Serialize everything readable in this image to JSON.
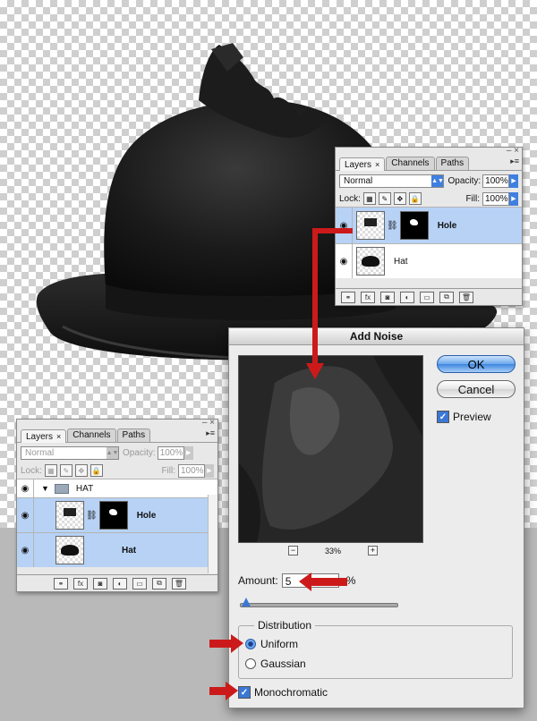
{
  "colors": {
    "selection": "#b7d2f5",
    "accent_blue": "#3f7fe0",
    "annotation_red": "#cc1a1a"
  },
  "layers_top": {
    "tabs": [
      {
        "label": "Layers",
        "close": "×"
      },
      {
        "label": "Channels"
      },
      {
        "label": "Paths"
      }
    ],
    "menu_icon": "▸≡",
    "blend_mode": "Normal",
    "opacity_label": "Opacity:",
    "opacity_value": "100%",
    "lock_label": "Lock:",
    "fill_label": "Fill:",
    "fill_value": "100%",
    "layers": [
      {
        "name": "Hole",
        "selected": true
      },
      {
        "name": "Hat",
        "selected": false
      }
    ],
    "eye_icon": "eye-icon"
  },
  "layers_bottom": {
    "tabs": [
      {
        "label": "Layers",
        "close": "×"
      },
      {
        "label": "Channels"
      },
      {
        "label": "Paths"
      }
    ],
    "blend_mode": "Normal",
    "opacity_label": "Opacity:",
    "opacity_value": "100%",
    "lock_label": "Lock:",
    "fill_label": "Fill:",
    "fill_value": "100%",
    "group": {
      "name": "HAT"
    },
    "layers": [
      {
        "name": "Hole",
        "selected": true
      },
      {
        "name": "Hat",
        "selected": true
      }
    ]
  },
  "dialog": {
    "title": "Add Noise",
    "ok_label": "OK",
    "cancel_label": "Cancel",
    "preview_label": "Preview",
    "preview_checked": true,
    "zoom_value": "33%",
    "zoom_minus": "−",
    "zoom_plus": "+",
    "amount_label": "Amount:",
    "amount_value": "5",
    "amount_unit": "%",
    "distribution_label": "Distribution",
    "uniform_label": "Uniform",
    "gaussian_label": "Gaussian",
    "distribution_selected": "Uniform",
    "monochromatic_label": "Monochromatic",
    "monochromatic_checked": true
  }
}
